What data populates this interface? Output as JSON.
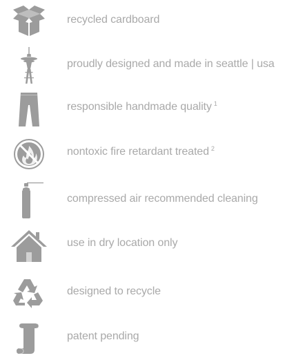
{
  "icon_color": "#9c9c9c",
  "text_color": "#a9a9a9",
  "features": [
    {
      "icon": "cardboard-box-icon",
      "text": "recycled cardboard"
    },
    {
      "icon": "space-needle-icon",
      "text": "proudly designed and made in seattle | usa"
    },
    {
      "icon": "pants-icon",
      "text": "responsible handmade quality",
      "footnote": "1"
    },
    {
      "icon": "no-fire-icon",
      "text": "nontoxic fire retardant treated",
      "footnote": "2"
    },
    {
      "icon": "compressed-air-can-icon",
      "text": "compressed air recommended cleaning"
    },
    {
      "icon": "house-icon",
      "text": "use in dry location only"
    },
    {
      "icon": "recycle-icon",
      "text": "designed to recycle"
    },
    {
      "icon": "scroll-icon",
      "text": "patent pending"
    }
  ]
}
